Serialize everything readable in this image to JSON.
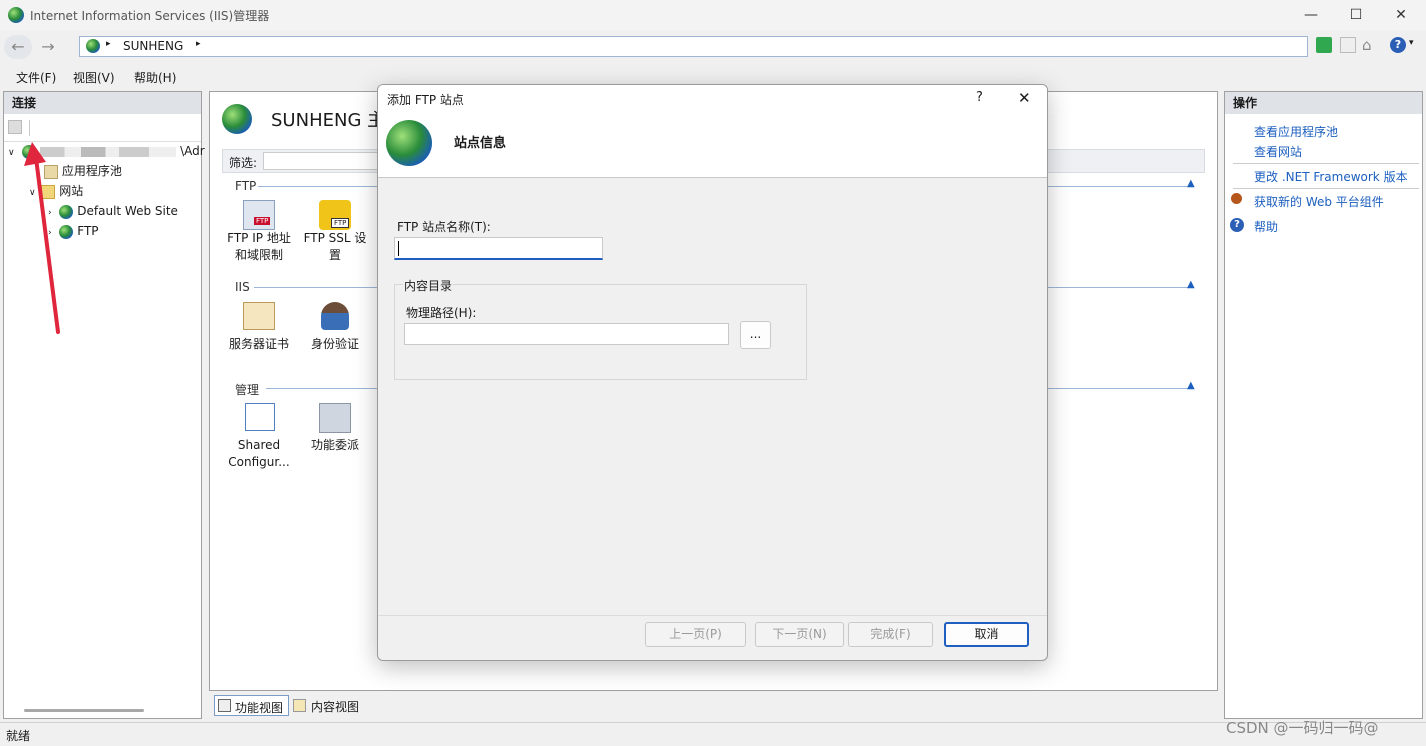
{
  "window": {
    "title": "Internet Information Services (IIS)管理器",
    "minimize": "—",
    "maximize": "☐",
    "close": "✕"
  },
  "address": {
    "path": "SUNHENG",
    "sep": "▸"
  },
  "menu": [
    "文件(F)",
    "视图(V)",
    "帮助(H)"
  ],
  "connections": {
    "header": "连接",
    "server_label": "\\Adr",
    "items": [
      {
        "label": "应用程序池"
      },
      {
        "label": "网站"
      },
      {
        "label": "Default Web Site"
      },
      {
        "label": "FTP"
      }
    ]
  },
  "center": {
    "title": "SUNHENG 主",
    "filter_label": "筛选:",
    "sections": [
      {
        "name": "FTP",
        "features": [
          "FTP IP 地址和域限制",
          "FTP SSL 设置"
        ]
      },
      {
        "name": "IIS",
        "features": [
          "服务器证书",
          "身份验证"
        ]
      },
      {
        "name": "管理",
        "features": [
          "Shared Configur...",
          "功能委派"
        ]
      }
    ],
    "feature_view": "功能视图",
    "content_view": "内容视图"
  },
  "actions": {
    "header": "操作",
    "links": [
      "查看应用程序池",
      "查看网站",
      "更改 .NET Framework 版本",
      "获取新的 Web 平台组件",
      "帮助"
    ]
  },
  "status": {
    "text": "就绪",
    "watermark": "CSDN @一码归一码@"
  },
  "dialog": {
    "title": "添加 FTP 站点",
    "help": "?",
    "close": "✕",
    "heading": "站点信息",
    "site_name_label": "FTP 站点名称(T):",
    "site_name_value": "",
    "content_dir_label": "内容目录",
    "physical_path_label": "物理路径(H):",
    "physical_path_value": "",
    "browse": "...",
    "buttons": {
      "prev": "上一页(P)",
      "next": "下一页(N)",
      "finish": "完成(F)",
      "cancel": "取消"
    }
  },
  "colors": {
    "link": "#1c5fbf",
    "arrow": "#e0263c",
    "panel_header": "#dfe3e8"
  }
}
